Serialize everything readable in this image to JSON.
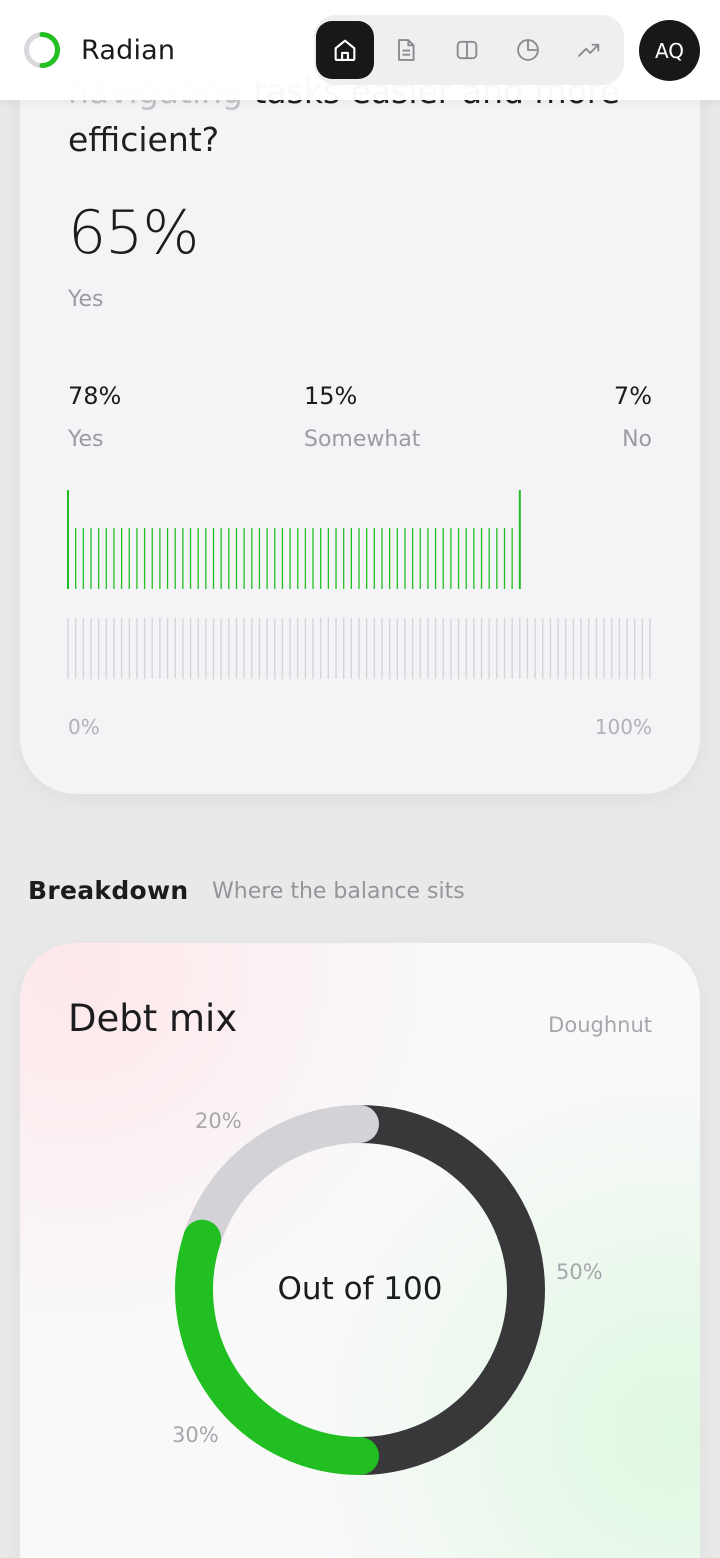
{
  "header": {
    "brand": "Radian",
    "accent_color": "#22bf22",
    "nav": [
      {
        "id": "home",
        "icon": "home-icon",
        "active": true
      },
      {
        "id": "document",
        "icon": "document-icon",
        "active": false
      },
      {
        "id": "split",
        "icon": "split-view-icon",
        "active": false
      },
      {
        "id": "pie",
        "icon": "pie-chart-icon",
        "active": false
      },
      {
        "id": "trend",
        "icon": "trending-up-icon",
        "active": false
      }
    ],
    "avatar": "AQ"
  },
  "survey": {
    "question_line1_faded": "navigating",
    "question_line1_rest": " tasks easier and more",
    "question_line2": "efficient?",
    "headline_value": "65%",
    "headline_label": "Yes",
    "stats": [
      {
        "value": "78%",
        "label": "Yes"
      },
      {
        "value": "15%",
        "label": "Somewhat"
      },
      {
        "value": "7%",
        "label": "No"
      }
    ],
    "progress_fraction": 0.78,
    "bar_color": "#22bf22",
    "track_color": "#d3d3d8",
    "axis_min": "0%",
    "axis_max": "100%"
  },
  "breakdown": {
    "title": "Breakdown",
    "subtitle": "Where the balance sits"
  },
  "chart_data": {
    "type": "pie",
    "title": "Debt mix",
    "subtitle": "Doughnut",
    "center_label": "Out of 100",
    "slices": [
      {
        "value": 50,
        "label": "50%",
        "color": "#38383b"
      },
      {
        "value": 30,
        "label": "30%",
        "color": "#22bf22"
      },
      {
        "value": 20,
        "label": "20%",
        "color": "#d3d3d7"
      }
    ]
  }
}
